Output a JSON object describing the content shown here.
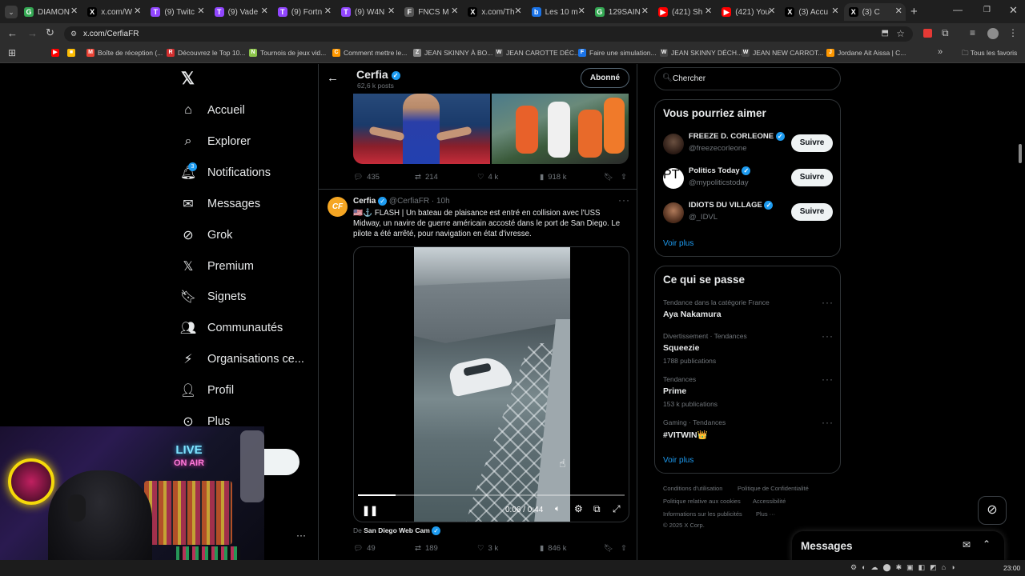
{
  "browser": {
    "tabs": [
      {
        "label": "DIAMON",
        "color": "#34a853",
        "glyph": "G"
      },
      {
        "label": "x.com/W",
        "color": "#000000",
        "glyph": "X"
      },
      {
        "label": "(9) Twitc",
        "color": "#9146ff",
        "glyph": "T"
      },
      {
        "label": "(9) Vade",
        "color": "#9146ff",
        "glyph": "T"
      },
      {
        "label": "(9) Fortn",
        "color": "#9146ff",
        "glyph": "T"
      },
      {
        "label": "(9) W4N",
        "color": "#9146ff",
        "glyph": "T"
      },
      {
        "label": "FNCS M",
        "color": "#555555",
        "glyph": "F"
      },
      {
        "label": "x.com/Th",
        "color": "#000000",
        "glyph": "X"
      },
      {
        "label": "Les 10 m",
        "color": "#1a73e8",
        "glyph": "b"
      },
      {
        "label": "129SAIN",
        "color": "#34a853",
        "glyph": "G"
      },
      {
        "label": "(421) Sh",
        "color": "#ff0000",
        "glyph": "▶"
      },
      {
        "label": "(421) You",
        "color": "#ff0000",
        "glyph": "▶"
      },
      {
        "label": "(3) Accu",
        "color": "#000000",
        "glyph": "X"
      },
      {
        "label": "(3) C",
        "color": "#000000",
        "glyph": "X"
      }
    ],
    "url": "x.com/CerfiaFR",
    "bookmarks": [
      {
        "label": "",
        "color": "#ff0000",
        "glyph": "▶"
      },
      {
        "label": "",
        "color": "#fbbc04",
        "glyph": "■"
      },
      {
        "label": "Boîte de réception (...",
        "color": "#ea4335",
        "glyph": "M"
      },
      {
        "label": "Découvrez le Top 10...",
        "color": "#d32f2f",
        "glyph": "R"
      },
      {
        "label": "Tournois de jeux vid...",
        "color": "#8bc34a",
        "glyph": "N"
      },
      {
        "label": "Comment mettre le...",
        "color": "#ff9800",
        "glyph": "C"
      },
      {
        "label": "JEAN SKINNY À BO...",
        "color": "#888888",
        "glyph": "Z"
      },
      {
        "label": "JEAN CAROTTE DÉC...",
        "color": "#444444",
        "glyph": "W"
      },
      {
        "label": "Faire une simulation...",
        "color": "#1a73e8",
        "glyph": "F"
      },
      {
        "label": "JEAN SKINNY DÉCH...",
        "color": "#444444",
        "glyph": "W"
      },
      {
        "label": "JEAN NEW CARROT...",
        "color": "#444444",
        "glyph": "W"
      },
      {
        "label": "Jordane Ait Aissa | C...",
        "color": "#ff9800",
        "glyph": "J"
      }
    ],
    "all_bookmarks": "Tous les favoris"
  },
  "nav": {
    "items": [
      {
        "label": "Accueil",
        "icon": "home-icon"
      },
      {
        "label": "Explorer",
        "icon": "search-icon"
      },
      {
        "label": "Notifications",
        "icon": "bell-icon",
        "badge": "3"
      },
      {
        "label": "Messages",
        "icon": "mail-icon"
      },
      {
        "label": "Grok",
        "icon": "grok-icon"
      },
      {
        "label": "Premium",
        "icon": "x-logo-icon"
      },
      {
        "label": "Signets",
        "icon": "bookmark-icon"
      },
      {
        "label": "Communautés",
        "icon": "communities-icon"
      },
      {
        "label": "Organisations ce...",
        "icon": "lightning-icon"
      },
      {
        "label": "Profil",
        "icon": "person-icon"
      },
      {
        "label": "Plus",
        "icon": "more-circle-icon"
      }
    ]
  },
  "header": {
    "name": "Cerfia",
    "posts": "62,6 k posts",
    "follow_state": "Abonné"
  },
  "tweet1": {
    "replies": "435",
    "retweets": "214",
    "likes": "4 k",
    "views": "918 k"
  },
  "tweet2": {
    "name": "Cerfia",
    "handle": "@CerfiaFR",
    "time": "· 10h",
    "avatar_text": "CF",
    "text": "🇺🇸⚓️ FLASH | Un bateau de plaisance est entré en collision avec l'USS Midway, un navire de guerre américain accosté dans le port de San Diego. Le pilote a été arrêté, pour navigation en état d'ivresse.",
    "video_time": "0:06 / 0:44",
    "video_progress": 0.14,
    "source_prefix": "De",
    "source": "San Diego Web Cam",
    "replies": "49",
    "retweets": "189",
    "likes": "3 k",
    "views": "846 k"
  },
  "search": {
    "placeholder": "Chercher"
  },
  "suggestions": {
    "title": "Vous pourriez aimer",
    "users": [
      {
        "name": "FREEZE D. CORLEONE",
        "handle": "@freezecorleone",
        "button": "Suivre"
      },
      {
        "name": "Politics Today",
        "handle": "@mypoliticstoday",
        "button": "Suivre",
        "avatar_text": "PT"
      },
      {
        "name": "IDIOTS DU VILLAGE",
        "handle": "@_IDVL",
        "button": "Suivre"
      }
    ],
    "more": "Voir plus"
  },
  "trends": {
    "title": "Ce qui se passe",
    "items": [
      {
        "context": "Tendance dans la catégorie France",
        "name": "Aya Nakamura",
        "count": ""
      },
      {
        "context": "Divertissement · Tendances",
        "name": "Squeezie",
        "count": "1788 publications"
      },
      {
        "context": "Tendances",
        "name": "Prime",
        "count": "153 k publications"
      },
      {
        "context": "Gaming · Tendances",
        "name": "#VITWIN👑",
        "count": ""
      }
    ],
    "more": "Voir plus"
  },
  "footer": {
    "links": [
      "Conditions d'utilisation",
      "Politique de Confidentialité",
      "Politique relative aux cookies",
      "Accessibilité",
      "Informations sur les publicités",
      "Plus ···"
    ],
    "copyright": "© 2025 X Corp."
  },
  "messages_drawer": {
    "title": "Messages"
  },
  "webcam": {
    "sign_line1": "LIVE",
    "sign_line2": "ON AIR"
  },
  "taskbar": {
    "clock": "23:00"
  }
}
